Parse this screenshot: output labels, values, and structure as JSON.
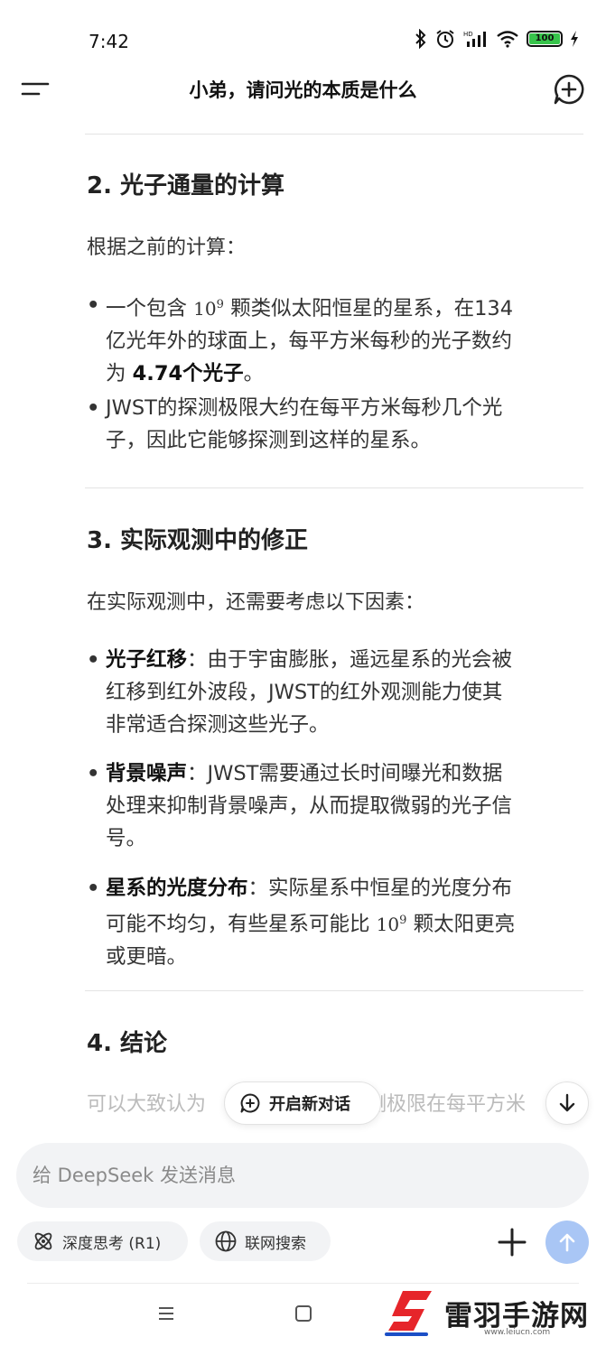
{
  "status_bar": {
    "time": "7:42",
    "battery_level": "100",
    "icons": [
      "bluetooth-icon",
      "alarm-icon",
      "hd-signal-icon",
      "wifi-icon",
      "battery-icon",
      "charging-icon"
    ]
  },
  "header": {
    "title": "小弟，请问光的本质是什么",
    "left_icon": "menu-icon",
    "right_icon": "new-chat-icon"
  },
  "content": {
    "section2": {
      "heading": "2. 光子通量的计算",
      "intro": "根据之前的计算：",
      "bullet1": {
        "pre": "一个包含",
        "math_base": "10",
        "math_exp": "9",
        "mid": "颗类似太阳恒星的星系，在134",
        "line2": "亿光年外的球面上，每平方米每秒的光子数约",
        "line3_pre": "为 ",
        "line3_bold": "4.74个光子",
        "line3_post": "。"
      },
      "bullet2": {
        "line1": "JWST的探测极限大约在每平方米每秒几个光",
        "line2": "子，因此它能够探测到这样的星系。"
      }
    },
    "section3": {
      "heading": "3. 实际观测中的修正",
      "intro": "在实际观测中，还需要考虑以下因素：",
      "bullet1": {
        "label": "光子红移",
        "line1": "：由于宇宙膨胀，遥远星系的光会被",
        "line2": "红移到红外波段，JWST的红外观测能力使其",
        "line3": "非常适合探测这些光子。"
      },
      "bullet2": {
        "label": "背景噪声",
        "line1": "：JWST需要通过长时间曝光和数据",
        "line2": "处理来抑制背景噪声，从而提取微弱的光子信",
        "line3": "号。"
      },
      "bullet3": {
        "label": "星系的光度分布",
        "line1": "：实际星系中恒星的光度分布",
        "line2_pre": "可能不均匀，有些星系可能比",
        "math_base": "10",
        "math_exp": "9",
        "line2_post": "颗太阳更亮",
        "line3": "或更暗。"
      }
    },
    "section4": {
      "heading": "4. 结论",
      "partial_left": "可以大致认为",
      "partial_right": "测极限在每平方米"
    }
  },
  "floating": {
    "new_chat_label": "开启新对话",
    "scroll_down_icon": "arrow-down-icon"
  },
  "composer": {
    "placeholder": "给 DeepSeek 发送消息",
    "value": "",
    "deep_think_label": "深度思考 (R1)",
    "web_search_label": "联网搜索",
    "plus_icon": "plus-icon",
    "send_icon": "send-arrow-icon"
  },
  "nav_bar": {
    "items": [
      "nav-menu-icon",
      "nav-home-icon"
    ]
  },
  "watermark": {
    "text": "雷羽手游网",
    "url": "www.leiucn.com"
  }
}
